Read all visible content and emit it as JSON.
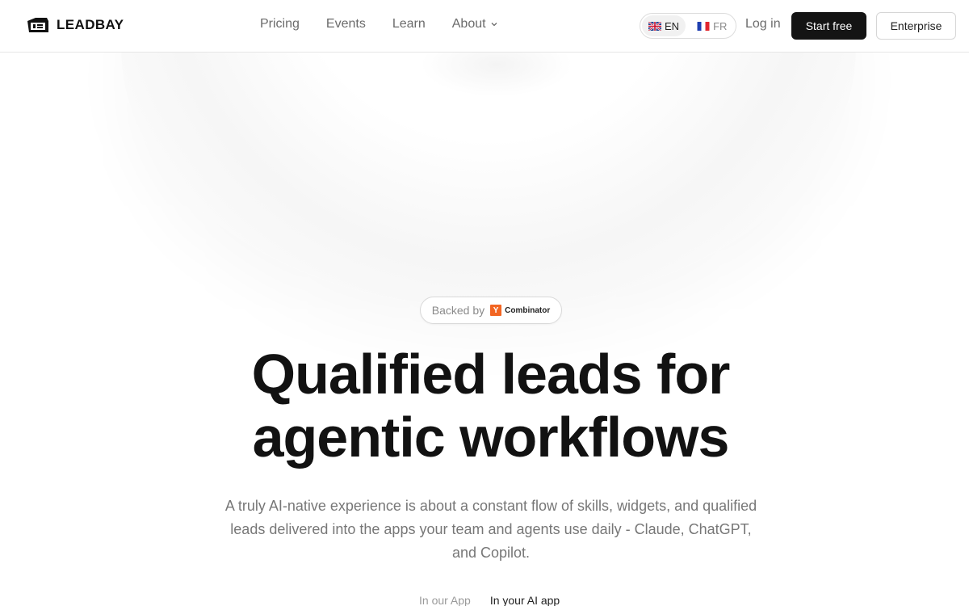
{
  "header": {
    "brand": "LEADBAY",
    "nav": [
      {
        "label": "Pricing"
      },
      {
        "label": "Events"
      },
      {
        "label": "Learn"
      },
      {
        "label": "About"
      }
    ],
    "languages": [
      {
        "code": "EN",
        "flag": "uk-flag-icon",
        "active": true
      },
      {
        "code": "FR",
        "flag": "fr-flag-icon",
        "active": false
      }
    ],
    "login_label": "Log in",
    "start_label": "Start free",
    "enterprise_label": "Enterprise"
  },
  "hero": {
    "backed_label": "Backed by",
    "backer_mark": "Y",
    "backer_name": "Combinator",
    "title_line1": "Qualified leads for",
    "title_line2": "agentic workflows",
    "subtitle": "A truly AI-native experience is about a constant flow of skills, widgets, and qualified leads delivered into the apps your team and agents use daily - Claude, ChatGPT, and Copilot.",
    "tabs": [
      {
        "label": "In our App",
        "active": false
      },
      {
        "label": "In your AI app",
        "active": true
      }
    ]
  },
  "colors": {
    "accent_dark": "#141414",
    "yc_orange": "#f26522",
    "muted_text": "#777777"
  }
}
